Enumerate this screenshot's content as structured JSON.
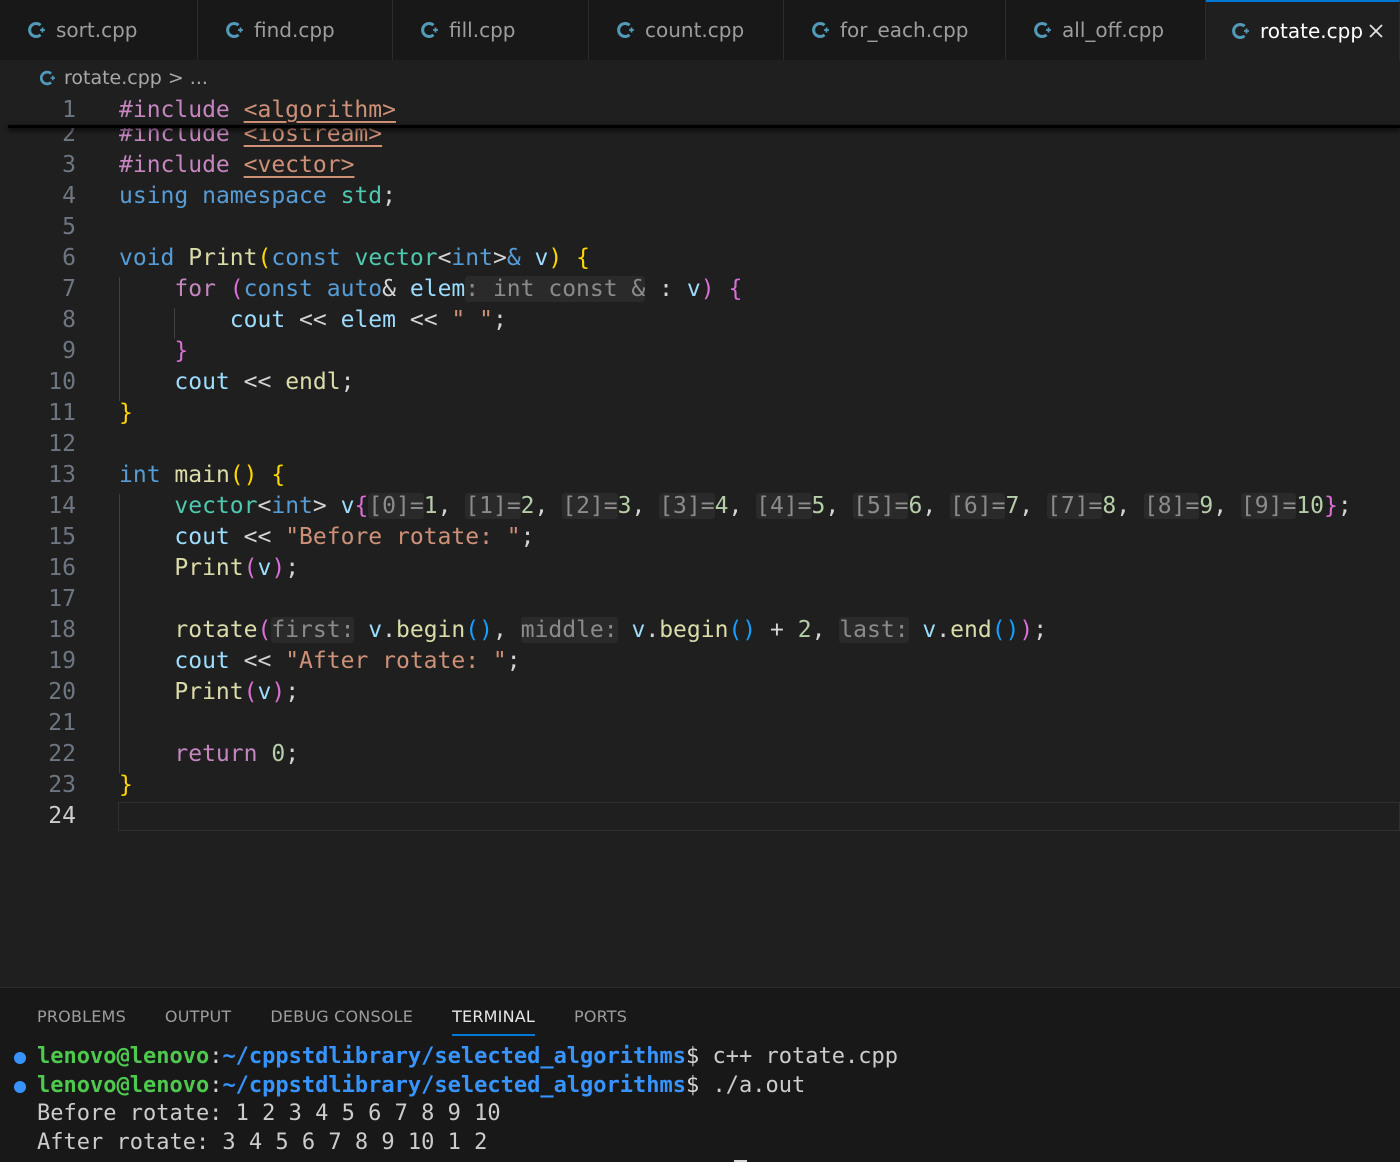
{
  "tabs": [
    {
      "label": "sort.cpp",
      "icon": "cpp-file-icon"
    },
    {
      "label": "find.cpp",
      "icon": "cpp-file-icon"
    },
    {
      "label": "fill.cpp",
      "icon": "cpp-file-icon"
    },
    {
      "label": "count.cpp",
      "icon": "cpp-file-icon"
    },
    {
      "label": "for_each.cpp",
      "icon": "cpp-file-icon"
    },
    {
      "label": "all_off.cpp",
      "icon": "cpp-file-icon"
    },
    {
      "label": "rotate.cpp",
      "icon": "cpp-file-icon",
      "active": true
    }
  ],
  "breadcrumb": {
    "file": "rotate.cpp",
    "separator": ">",
    "more": "..."
  },
  "editor": {
    "line_numbers": [
      "1",
      "2",
      "3",
      "4",
      "5",
      "6",
      "7",
      "8",
      "9",
      "10",
      "11",
      "12",
      "13",
      "14",
      "15",
      "16",
      "17",
      "18",
      "19",
      "20",
      "21",
      "22",
      "23",
      "24"
    ],
    "current_line": "24",
    "code": {
      "l1_directive": "#include",
      "l1_header": "<algorithm>",
      "l2_directive": "#include",
      "l2_header": "<iostream>",
      "l3_directive": "#include",
      "l3_header": "<vector>",
      "l4_using": "using",
      "l4_namespace": "namespace",
      "l4_std": "std",
      "l6_void": "void",
      "l6_fn": "Print",
      "l6_const": "const",
      "l6_type": "vector",
      "l6_int": "int",
      "l6_amp": "&",
      "l6_param": "v",
      "l7_for": "for",
      "l7_const": "const",
      "l7_auto": "auto",
      "l7_amp": "&",
      "l7_elem": "elem",
      "l7_hint": ": int const &",
      "l7_v": "v",
      "l8_cout": "cout",
      "l8_op": "<<",
      "l8_elem": "elem",
      "l8_str": "\" \"",
      "l10_cout": "cout",
      "l10_op": "<<",
      "l10_endl": "endl",
      "l13_int": "int",
      "l13_fn": "main",
      "l14_type": "vector",
      "l14_int": "int",
      "l14_v": "v",
      "l14_items": [
        {
          "hint": "[0]=",
          "val": "1"
        },
        {
          "hint": "[1]=",
          "val": "2"
        },
        {
          "hint": "[2]=",
          "val": "3"
        },
        {
          "hint": "[3]=",
          "val": "4"
        },
        {
          "hint": "[4]=",
          "val": "5"
        },
        {
          "hint": "[5]=",
          "val": "6"
        },
        {
          "hint": "[6]=",
          "val": "7"
        },
        {
          "hint": "[7]=",
          "val": "8"
        },
        {
          "hint": "[8]=",
          "val": "9"
        },
        {
          "hint": "[9]=",
          "val": "10"
        }
      ],
      "l15_cout": "cout",
      "l15_op": "<<",
      "l15_str": "\"Before rotate: \"",
      "l16_fn": "Print",
      "l16_v": "v",
      "l18_fn": "rotate",
      "l18_hint_first": "first:",
      "l18_v1": "v",
      "l18_begin1": "begin",
      "l18_hint_middle": "middle:",
      "l18_v2": "v",
      "l18_begin2": "begin",
      "l18_plus": "+",
      "l18_num": "2",
      "l18_hint_last": "last:",
      "l18_v3": "v",
      "l18_end": "end",
      "l19_cout": "cout",
      "l19_op": "<<",
      "l19_str": "\"After rotate: \"",
      "l20_fn": "Print",
      "l20_v": "v",
      "l22_return": "return",
      "l22_num": "0"
    }
  },
  "panel": {
    "tabs": [
      "PROBLEMS",
      "OUTPUT",
      "DEBUG CONSOLE",
      "TERMINAL",
      "PORTS"
    ],
    "active_tab": "TERMINAL",
    "terminal": {
      "user": "lenovo@lenovo",
      "path": "~/cppstdlibrary/selected_algorithms",
      "prompt": "$",
      "cmd1": "c++ rotate.cpp",
      "cmd2": "./a.out",
      "out1": "Before rotate: 1 2 3 4 5 6 7 8 9 10",
      "out2": "After rotate: 3 4 5 6 7 8 9 10 1 2"
    }
  },
  "colors": {
    "accent": "#0078d4",
    "cpp_icon": "#519aba",
    "terminal_dot": "#3794ff"
  }
}
